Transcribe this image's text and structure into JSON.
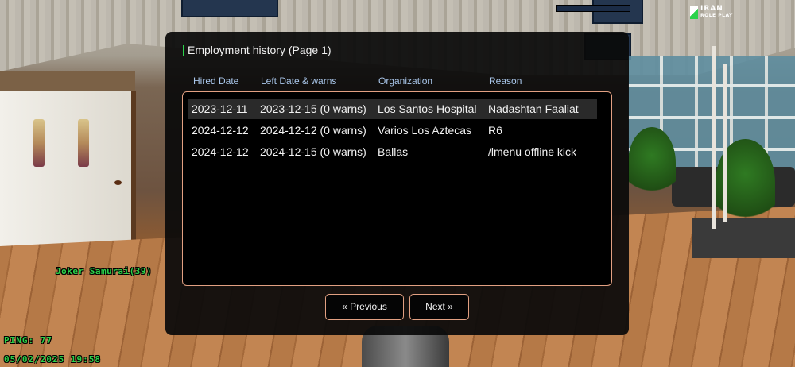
{
  "hud": {
    "player_nametag": "Joker Samurai(39)",
    "ping": "PING: 77",
    "datetime": "05/02/2025 19:58",
    "logo_line1": "IRAN",
    "logo_line2": "ROLE PLAY",
    "hud_color": "#2bd24a"
  },
  "dialog": {
    "title": "Employment history (Page 1)",
    "accent_color": "#e2a082",
    "columns": [
      "Hired Date",
      "Left Date & warns",
      "Organization",
      "Reason"
    ],
    "rows": [
      {
        "hired": "2023-12-11",
        "left": "2023-12-15 (0 warns)",
        "organization": "Los Santos Hospital",
        "reason": "Nadashtan Faaliat"
      },
      {
        "hired": "2024-12-12",
        "left": "2024-12-12 (0 warns)",
        "organization": "Varios Los Aztecas",
        "reason": "R6"
      },
      {
        "hired": "2024-12-12",
        "left": "2024-12-15 (0 warns)",
        "organization": "Ballas",
        "reason": "/lmenu offline kick"
      }
    ],
    "selected_row": 0,
    "previous_label": "« Previous",
    "next_label": "Next »"
  }
}
